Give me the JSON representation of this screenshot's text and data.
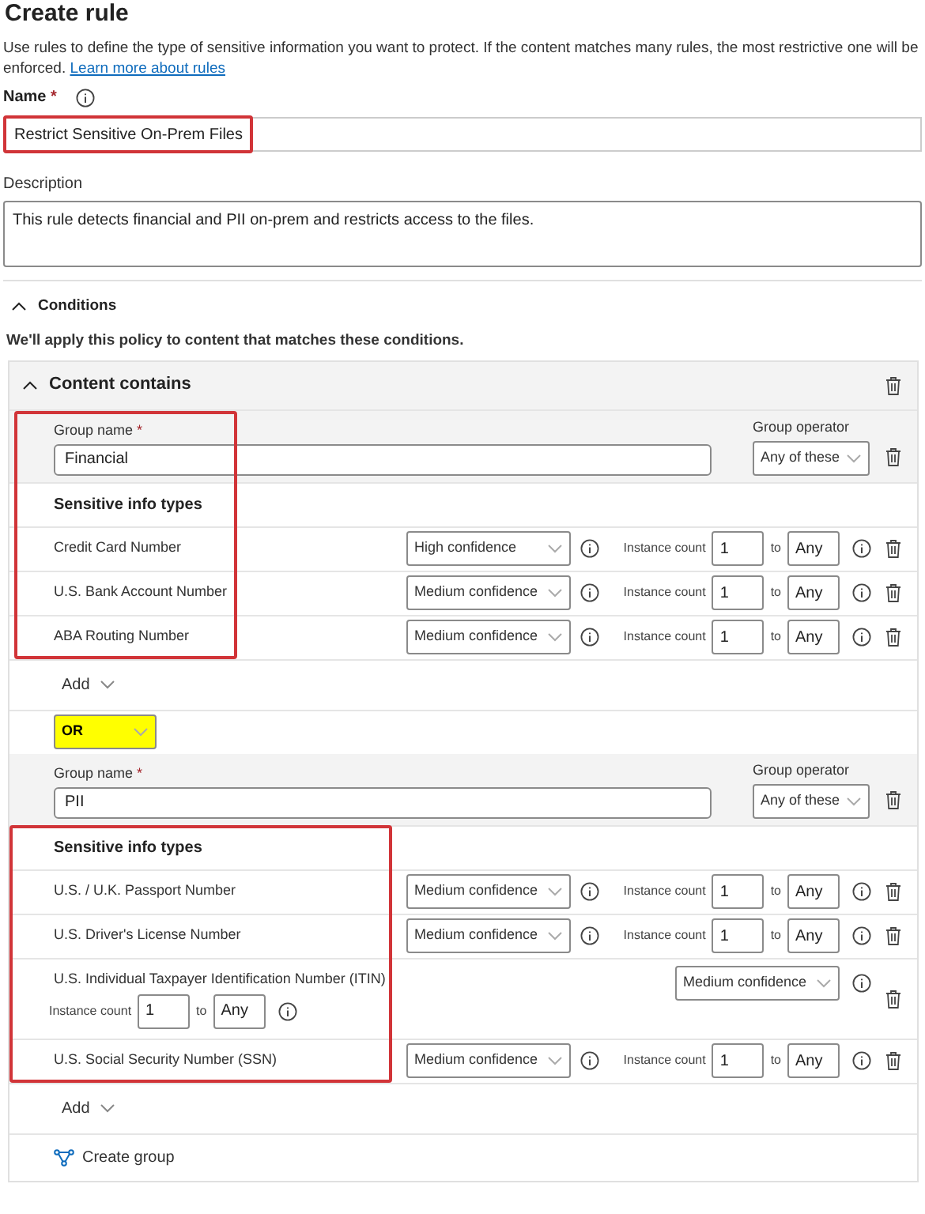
{
  "title": "Create rule",
  "intro": "Use rules to define the type of sensitive information you want to protect. If the content matches many rules, the most restrictive one will be enforced.",
  "learn_more": "Learn more about rules",
  "name": {
    "label": "Name",
    "required_mark": "*",
    "value": "Restrict Sensitive On-Prem Files",
    "highlighted": true
  },
  "description": {
    "label": "Description",
    "value": "This rule detects financial and PII on-prem and restricts access to the files."
  },
  "conditions": {
    "label": "Conditions",
    "expanded": true,
    "note": "We'll apply this policy to content that matches these conditions."
  },
  "content_contains": {
    "title": "Content contains",
    "expanded": true,
    "groups": [
      {
        "label": "Group name",
        "required_mark": "*",
        "value": "Financial",
        "operator_label": "Group operator",
        "operator": "Any of these",
        "types_heading": "Sensitive info types",
        "header_highlighted": true,
        "types_highlighted": true,
        "add": "Add",
        "join": {
          "value": "OR",
          "highlighted": true
        },
        "items": [
          {
            "kind": "inline",
            "name": "Credit Card Number",
            "confidence": "High confidence",
            "count_label": "Instance count",
            "min": "1",
            "to": "to",
            "max": "Any"
          },
          {
            "kind": "inline",
            "name": "U.S. Bank Account Number",
            "confidence": "Medium confidence",
            "count_label": "Instance count",
            "min": "1",
            "to": "to",
            "max": "Any"
          },
          {
            "kind": "inline",
            "name": "ABA Routing Number",
            "confidence": "Medium confidence",
            "count_label": "Instance count",
            "min": "1",
            "to": "to",
            "max": "Any"
          }
        ]
      },
      {
        "label": "Group name",
        "required_mark": "*",
        "value": "PII",
        "operator_label": "Group operator",
        "operator": "Any of these",
        "types_heading": "Sensitive info types",
        "types_highlighted": true,
        "add": "Add",
        "items": [
          {
            "kind": "inline",
            "name": "U.S. / U.K. Passport Number",
            "confidence": "Medium confidence",
            "count_label": "Instance count",
            "min": "1",
            "to": "to",
            "max": "Any"
          },
          {
            "kind": "inline",
            "name": "U.S. Driver's License Number",
            "confidence": "Medium confidence",
            "count_label": "Instance count",
            "min": "1",
            "to": "to",
            "max": "Any"
          },
          {
            "kind": "wrapped",
            "name": "U.S. Individual Taxpayer Identification Number (ITIN)",
            "confidence": "Medium confidence",
            "count_label": "Instance count",
            "min": "1",
            "to": "to",
            "max": "Any"
          },
          {
            "kind": "inline",
            "name": "U.S. Social Security Number (SSN)",
            "confidence": "Medium confidence",
            "count_label": "Instance count",
            "min": "1",
            "to": "to",
            "max": "Any"
          }
        ]
      }
    ],
    "create_group": "Create group"
  }
}
